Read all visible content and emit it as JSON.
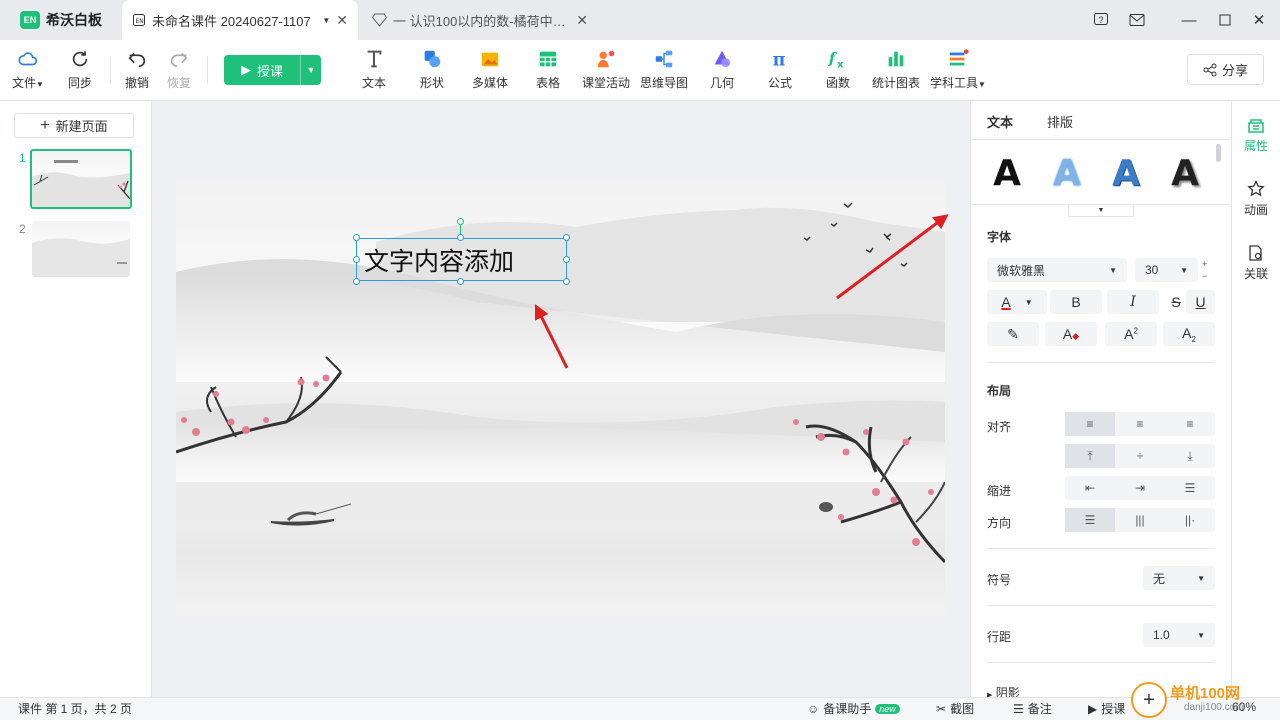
{
  "app": {
    "name": "希沃白板"
  },
  "tabs": [
    {
      "label": "未命名课件 20240627-1107"
    },
    {
      "label": "一 认识100以内的数-橘荷中心..."
    }
  ],
  "toolbar": {
    "file": "文件",
    "sync": "同步",
    "undo": "撤销",
    "redo": "恢复",
    "teach": "授课",
    "tools": [
      "文本",
      "形状",
      "多媒体",
      "表格",
      "课堂活动",
      "思维导图",
      "几何",
      "公式",
      "函数",
      "统计图表",
      "学科工具"
    ],
    "share": "分享"
  },
  "pages": {
    "new_page": "新建页面",
    "items": [
      {
        "num": "1"
      },
      {
        "num": "2"
      }
    ]
  },
  "slide": {
    "textbox": "文字内容添加"
  },
  "properties": {
    "tabs": [
      "文本",
      "排版"
    ],
    "font_section": "字体",
    "font_family": "微软雅黑",
    "font_size": "30",
    "layout_section": "布局",
    "align_label": "对齐",
    "indent_label": "缩进",
    "direction_label": "方向",
    "symbol_label": "符号",
    "symbol_value": "无",
    "linespacing_label": "行距",
    "linespacing_value": "1.0",
    "shadow_label": "阴影"
  },
  "sidebar": {
    "items": [
      "属性",
      "动画",
      "关联"
    ]
  },
  "status": {
    "page_info": "课件 第 1 页，共 2 页",
    "assistant": "备课助手",
    "new_badge": "new",
    "screenshot": "截图",
    "notes": "备注",
    "teach": "授课",
    "zoom": "60%"
  },
  "watermark": {
    "text": "单机100网",
    "url": "danji100.com"
  },
  "colors": {
    "accent": "#1ec07a",
    "selection": "#2d9cdb",
    "arrow": "#e02020"
  }
}
